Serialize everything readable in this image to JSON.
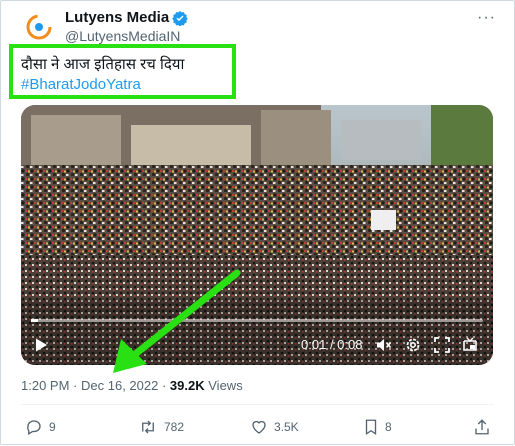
{
  "tweet": {
    "display_name": "Lutyens Media",
    "handle": "@LutyensMediaIN",
    "text": "दौसा ने आज इतिहास रच दिया",
    "hashtag": "#BharatJodoYatra",
    "time": "1:20 PM",
    "date": "Dec 16, 2022",
    "views_count": "39.2K",
    "views_label": "Views",
    "more_label": "···"
  },
  "video": {
    "elapsed": "0:01",
    "duration": "0:08",
    "progress_fraction": 0.015
  },
  "actions": {
    "replies": "9",
    "reposts": "782",
    "likes": "3.5K",
    "bookmarks": "8"
  },
  "colors": {
    "verified": "#1d9bf0",
    "highlight": "#29e012",
    "link": "#1d9bf0"
  }
}
